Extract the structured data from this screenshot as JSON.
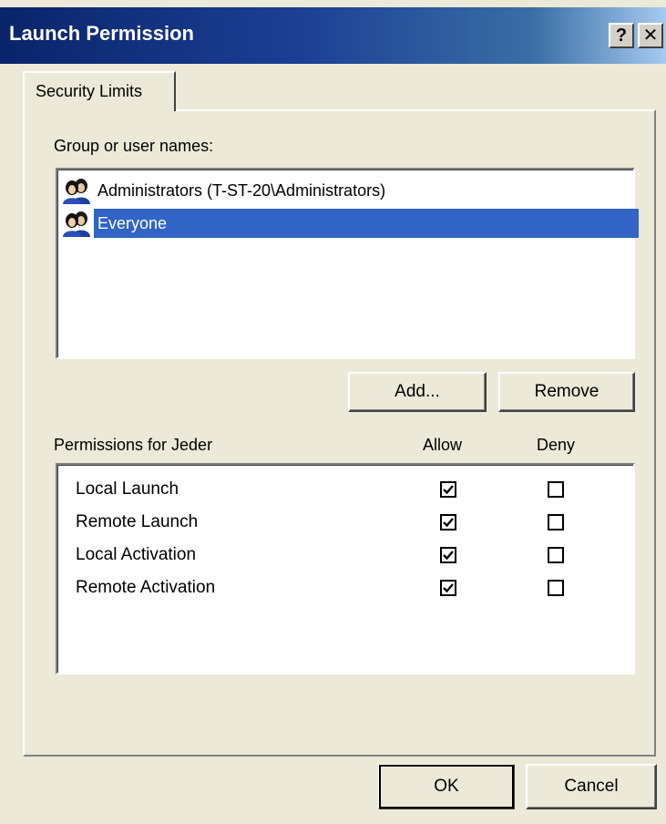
{
  "window": {
    "title": "Launch Permission",
    "help_label": "?",
    "close_label": "✕"
  },
  "tab": {
    "label": "Security Limits"
  },
  "groups": {
    "label": "Group or user names:",
    "users": [
      {
        "name": "Administrators (T-ST-20\\Administrators)",
        "icon": "users-group-icon",
        "selected": false
      },
      {
        "name": "Everyone",
        "icon": "users-group-icon",
        "selected": true
      }
    ],
    "add_label": "Add...",
    "remove_label": "Remove"
  },
  "permissions": {
    "label": "Permissions for Jeder",
    "allow_header": "Allow",
    "deny_header": "Deny",
    "items": [
      {
        "name": "Local Launch",
        "allow": true,
        "deny": false
      },
      {
        "name": "Remote Launch",
        "allow": true,
        "deny": false
      },
      {
        "name": "Local Activation",
        "allow": true,
        "deny": false
      },
      {
        "name": "Remote Activation",
        "allow": true,
        "deny": false
      }
    ]
  },
  "footer": {
    "ok_label": "OK",
    "cancel_label": "Cancel"
  },
  "colors": {
    "titlebar_start": "#0a246a",
    "titlebar_end": "#a6caf0",
    "selection": "#3164c4",
    "dialog_bg": "#ece9d8"
  }
}
